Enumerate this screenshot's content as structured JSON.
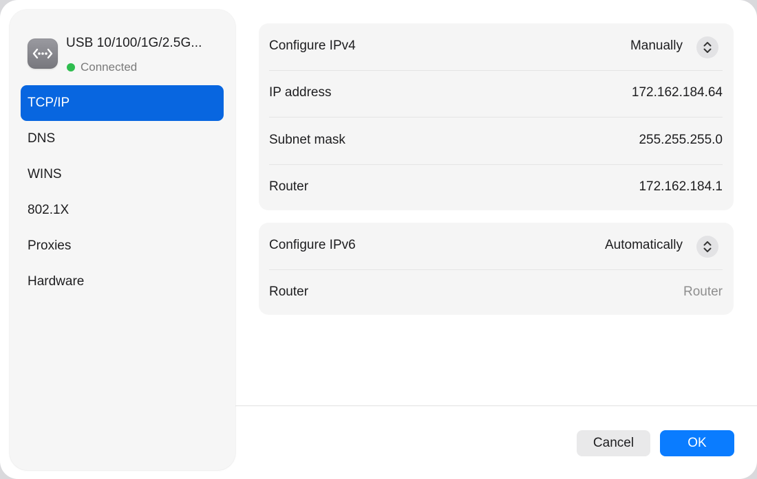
{
  "device": {
    "name": "USB 10/100/1G/2.5G...",
    "status": "Connected",
    "icon": "ethernet-icon",
    "status_color": "#2fbd4f"
  },
  "sidebar": {
    "items": [
      {
        "label": "TCP/IP",
        "selected": true
      },
      {
        "label": "DNS",
        "selected": false
      },
      {
        "label": "WINS",
        "selected": false
      },
      {
        "label": "802.1X",
        "selected": false
      },
      {
        "label": "Proxies",
        "selected": false
      },
      {
        "label": "Hardware",
        "selected": false
      }
    ],
    "selected_color": "#0866e0"
  },
  "ipv4": {
    "configure_label": "Configure IPv4",
    "configure_value": "Manually",
    "ip_label": "IP address",
    "ip_value": "172.162.184.64",
    "subnet_label": "Subnet mask",
    "subnet_value": "255.255.255.0",
    "router_label": "Router",
    "router_value": "172.162.184.1"
  },
  "ipv6": {
    "configure_label": "Configure IPv6",
    "configure_value": "Automatically",
    "router_label": "Router",
    "router_placeholder": "Router"
  },
  "footer": {
    "cancel_label": "Cancel",
    "ok_label": "OK",
    "ok_color": "#0a7cff"
  }
}
